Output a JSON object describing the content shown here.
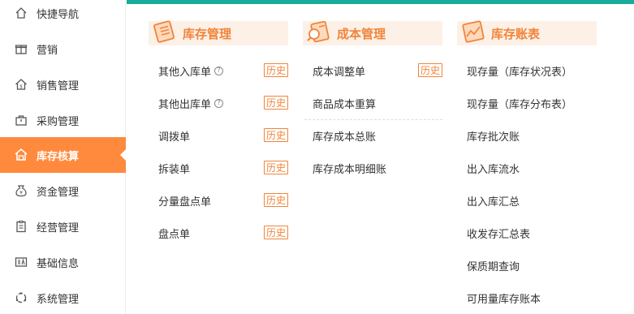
{
  "sidebar": {
    "items": [
      {
        "label": "快捷导航",
        "icon": "home-icon"
      },
      {
        "label": "营销",
        "icon": "gift-icon"
      },
      {
        "label": "销售管理",
        "icon": "sales-house-icon"
      },
      {
        "label": "采购管理",
        "icon": "shopping-bag-icon"
      },
      {
        "label": "库存核算",
        "icon": "warehouse-icon",
        "active": true
      },
      {
        "label": "资金管理",
        "icon": "money-bag-icon"
      },
      {
        "label": "经营管理",
        "icon": "clipboard-icon"
      },
      {
        "label": "基础信息",
        "icon": "id-card-icon"
      },
      {
        "label": "系统管理",
        "icon": "settings-ring-icon"
      }
    ]
  },
  "colors": {
    "accent": "#ff8a3d",
    "topbar": "#1aab9a",
    "header_bg": "#fdf0e6",
    "header_text": "#f0843a"
  },
  "columns": [
    {
      "title": "库存管理",
      "icon": "notebook-icon",
      "items": [
        {
          "label": "其他入库单",
          "help": "?",
          "badge": "历史"
        },
        {
          "label": "其他出库单",
          "help": "?",
          "badge": "历史"
        },
        {
          "label": "调拨单",
          "badge": "历史"
        },
        {
          "label": "拆装单",
          "badge": "历史"
        },
        {
          "label": "分量盘点单",
          "badge": "历史"
        },
        {
          "label": "盘点单",
          "badge": "历史"
        }
      ]
    },
    {
      "title": "成本管理",
      "icon": "magnifier-document-icon",
      "items": [
        {
          "label": "成本调整单",
          "badge": "历史"
        },
        {
          "label": "商品成本重算"
        },
        {
          "label": "库存成本总账"
        },
        {
          "label": "库存成本明细账"
        }
      ]
    },
    {
      "title": "库存账表",
      "icon": "chart-document-icon",
      "items": [
        {
          "label": "现存量（库存状况表）"
        },
        {
          "label": "现存量（库存分布表）"
        },
        {
          "label": "库存批次账"
        },
        {
          "label": "出入库流水"
        },
        {
          "label": "出入库汇总"
        },
        {
          "label": "收发存汇总表"
        },
        {
          "label": "保质期查询"
        },
        {
          "label": "可用量库存账本"
        }
      ]
    }
  ]
}
